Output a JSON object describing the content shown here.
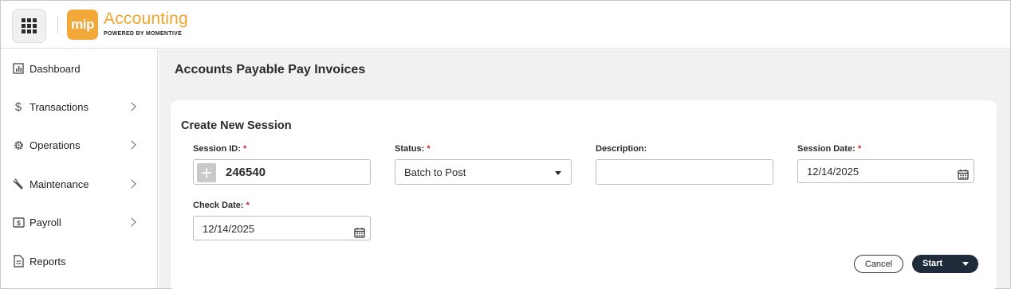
{
  "header": {
    "apps_icon": "grid-icon",
    "logo_text": "mip",
    "app_name": "Accounting",
    "app_sub": "POWERED BY MOMENTIVE",
    "brand_color": "#f3a93a"
  },
  "sidebar": {
    "items": [
      {
        "label": "Dashboard",
        "icon": "dashboard-icon",
        "has_submenu": false
      },
      {
        "label": "Transactions",
        "icon": "dollar-icon",
        "has_submenu": true
      },
      {
        "label": "Operations",
        "icon": "gear-icon",
        "has_submenu": true
      },
      {
        "label": "Maintenance",
        "icon": "wrench-icon",
        "has_submenu": true
      },
      {
        "label": "Payroll",
        "icon": "payroll-icon",
        "has_submenu": true
      },
      {
        "label": "Reports",
        "icon": "document-icon",
        "has_submenu": false
      }
    ]
  },
  "main": {
    "page_title": "Accounts Payable Pay Invoices",
    "card_title": "Create New Session",
    "fields": {
      "session_id": {
        "label": "Session ID:",
        "required": "*",
        "value": "246540"
      },
      "status": {
        "label": "Status:",
        "required": "*",
        "value": "Batch to Post"
      },
      "description": {
        "label": "Description:",
        "value": ""
      },
      "session_date": {
        "label": "Session Date:",
        "required": "*",
        "value": "12/14/2025"
      },
      "check_date": {
        "label": "Check Date:",
        "required": "*",
        "value": "12/14/2025"
      }
    },
    "buttons": {
      "cancel": "Cancel",
      "start": "Start"
    },
    "required_color": "#c62828",
    "primary_button_color": "#1f2a3b"
  }
}
